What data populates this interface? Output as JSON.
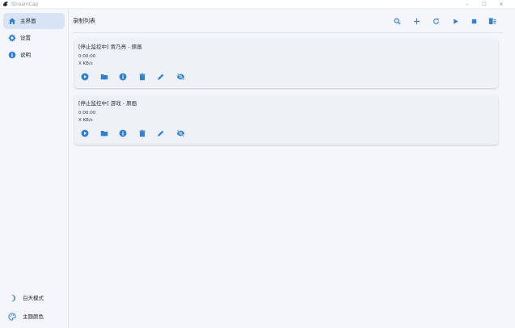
{
  "app": {
    "title": "StreamCap"
  },
  "window": {
    "minimize": "–",
    "maximize": "☐",
    "close": "✕"
  },
  "colors": {
    "accent": "#2f7fd6",
    "active_nav_bg": "#d6e4f5",
    "card_bg": "#eef1f6"
  },
  "sidebar": {
    "items": [
      {
        "label": "主界面",
        "icon": "home-icon",
        "active": true
      },
      {
        "label": "设置",
        "icon": "gear-icon",
        "active": false
      },
      {
        "label": "说明",
        "icon": "info-icon",
        "active": false
      }
    ],
    "bottom": [
      {
        "label": "白天模式",
        "icon": "moon-icon"
      },
      {
        "label": "主题颜色",
        "icon": "palette-icon"
      }
    ]
  },
  "main": {
    "title": "录制列表",
    "toolbar": [
      "search-icon",
      "add-icon",
      "refresh-icon",
      "play-icon",
      "stop-icon",
      "delete-all-icon"
    ],
    "cards": [
      {
        "title": "[停止监控中] 贾乃亮 - 原画",
        "time": "0:00:00",
        "speed": "X KB/s"
      },
      {
        "title": "[停止监控中] 游戏 - 原画",
        "time": "0:00:00",
        "speed": "X KB/s"
      }
    ],
    "card_actions": [
      "play-circle-icon",
      "folder-icon",
      "info-icon",
      "delete-icon",
      "edit-icon",
      "visibility-off-icon"
    ]
  }
}
